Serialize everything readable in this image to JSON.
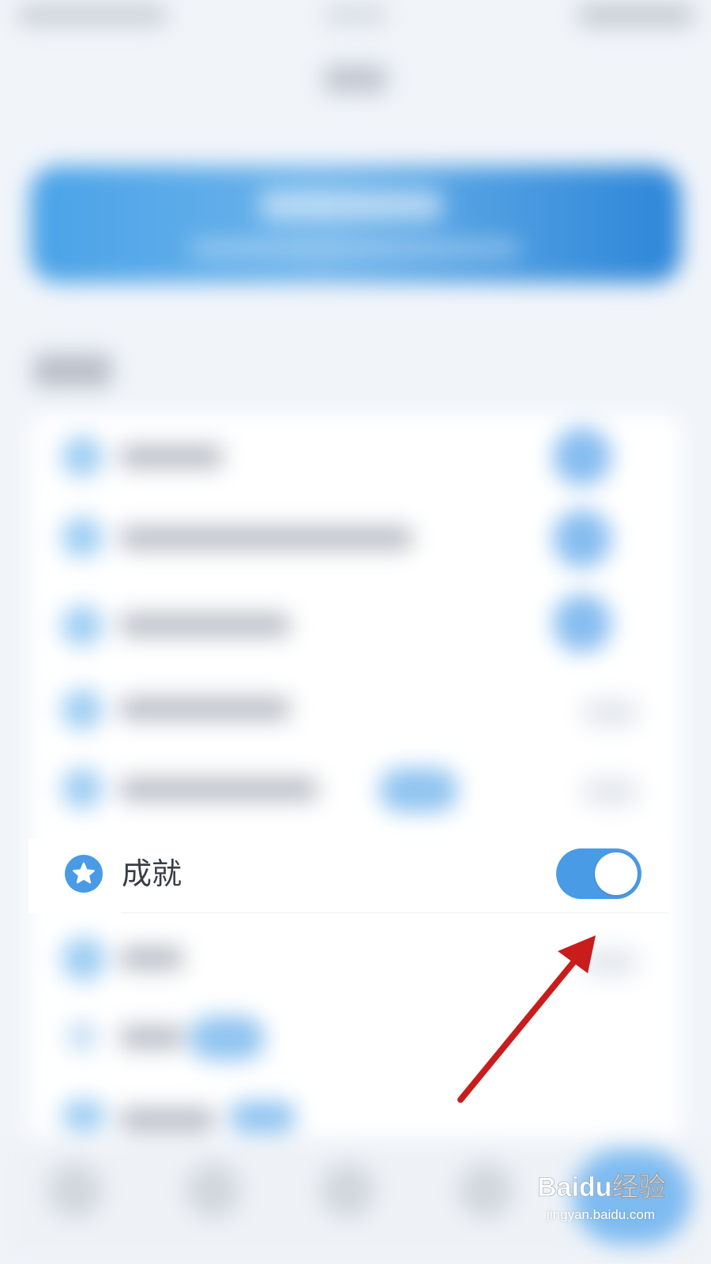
{
  "focused_setting": {
    "label": "成就",
    "icon": "star-icon",
    "toggle_on": true
  },
  "colors": {
    "accent": "#4a9be6",
    "arrow": "#c81d1d",
    "label_text": "#3a3e47"
  },
  "watermark": {
    "brand": "Baidu经验",
    "url": "jingyan.baidu.com"
  }
}
